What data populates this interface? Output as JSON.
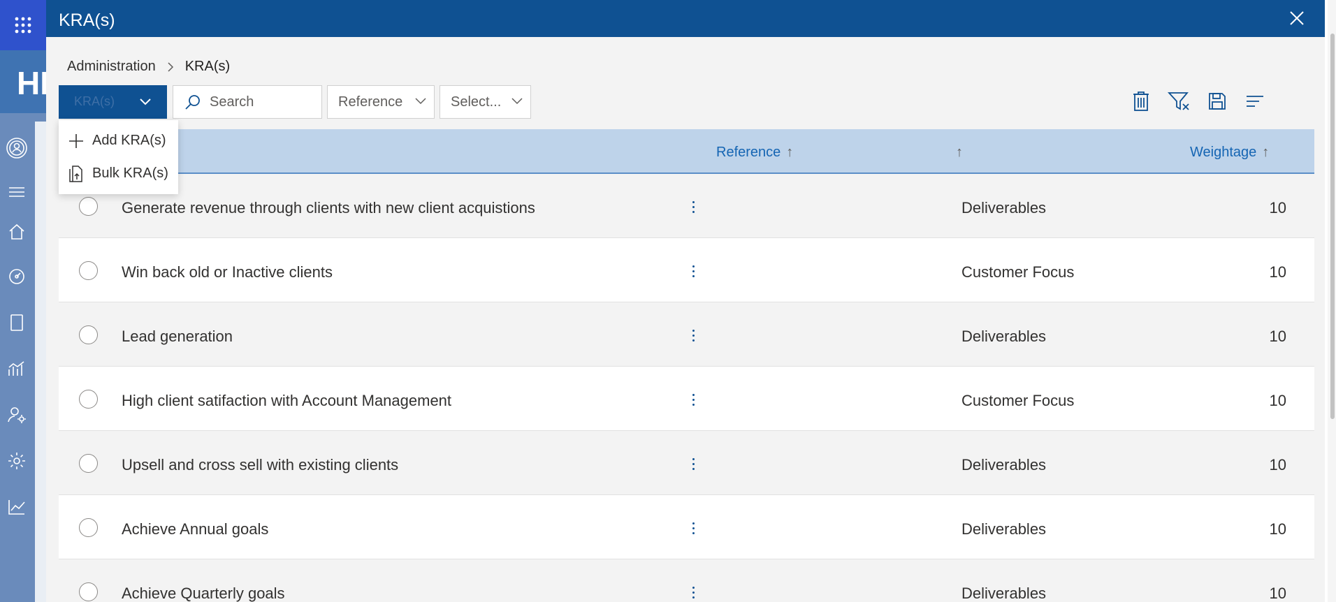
{
  "app": {
    "brand_text": "HI"
  },
  "panel": {
    "title": "KRA(s)",
    "close_label": "✕"
  },
  "breadcrumb": {
    "parent": "Administration",
    "current": "KRA(s)"
  },
  "toolbar": {
    "new_button_label": "KRA(s)",
    "search_placeholder": "Search",
    "reference_dropdown": "Reference",
    "select_dropdown": "Select...",
    "icons": [
      "delete-icon",
      "clear-filter-icon",
      "save-icon",
      "group-by-icon",
      "excel-export-icon"
    ]
  },
  "new_menu": {
    "items": [
      {
        "label": "Add KRA(s)",
        "icon": "add-icon"
      },
      {
        "label": "Bulk KRA(s)",
        "icon": "bulk-upload-icon"
      }
    ]
  },
  "table": {
    "columns": [
      {
        "label": "Reference",
        "arrow": "↑"
      },
      {
        "label": "",
        "arrow": "↑"
      },
      {
        "label": "Weightage",
        "arrow": "↑"
      }
    ],
    "rows": [
      {
        "name": "Generate revenue through clients with new client acquistions",
        "reference": "Deliverables",
        "weightage": "10"
      },
      {
        "name": "Win back old or Inactive clients",
        "reference": "Customer Focus",
        "weightage": "10"
      },
      {
        "name": "Lead generation",
        "reference": "Deliverables",
        "weightage": "10"
      },
      {
        "name": "High client satifaction with Account Management",
        "reference": "Customer Focus",
        "weightage": "10"
      },
      {
        "name": "Upsell and cross sell with existing clients",
        "reference": "Deliverables",
        "weightage": "10"
      },
      {
        "name": "Achieve Annual goals",
        "reference": "Deliverables",
        "weightage": "10"
      },
      {
        "name": "Achieve Quarterly goals",
        "reference": "Deliverables",
        "weightage": "10"
      }
    ]
  },
  "colors": {
    "header_blue": "#0f5192",
    "table_header": "#bed3ea",
    "link_blue": "#1565b3",
    "rail": "#6a8bbb"
  }
}
